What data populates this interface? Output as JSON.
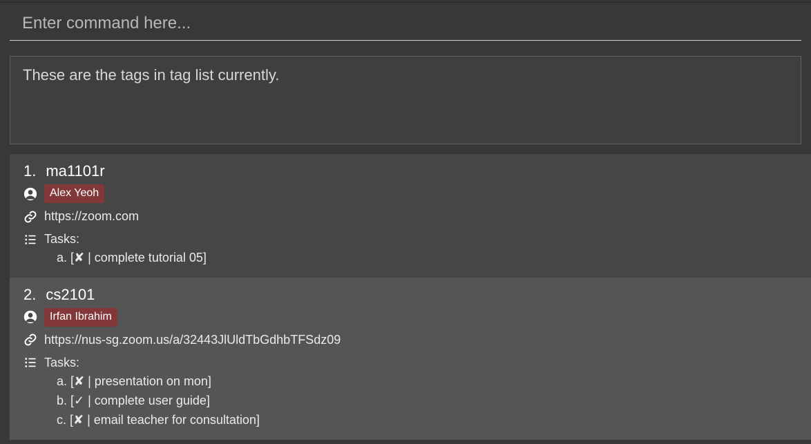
{
  "command": {
    "placeholder": "Enter command here..."
  },
  "result": {
    "message": "These are the tags in tag list currently."
  },
  "tasks_label": "Tasks:",
  "cards": [
    {
      "index": "1.",
      "name": "ma1101r",
      "person": "Alex Yeoh",
      "link": "https://zoom.com",
      "tasks": [
        {
          "letter": "a.",
          "done": false,
          "desc": "complete tutorial 05"
        }
      ]
    },
    {
      "index": "2.",
      "name": "cs2101",
      "person": "Irfan Ibrahim",
      "link": "https://nus-sg.zoom.us/a/32443JlUldTbGdhbTFSdz09",
      "tasks": [
        {
          "letter": "a.",
          "done": false,
          "desc": "presentation on mon"
        },
        {
          "letter": "b.",
          "done": true,
          "desc": "complete user guide"
        },
        {
          "letter": "c.",
          "done": false,
          "desc": "email teacher for consultation"
        }
      ]
    }
  ]
}
